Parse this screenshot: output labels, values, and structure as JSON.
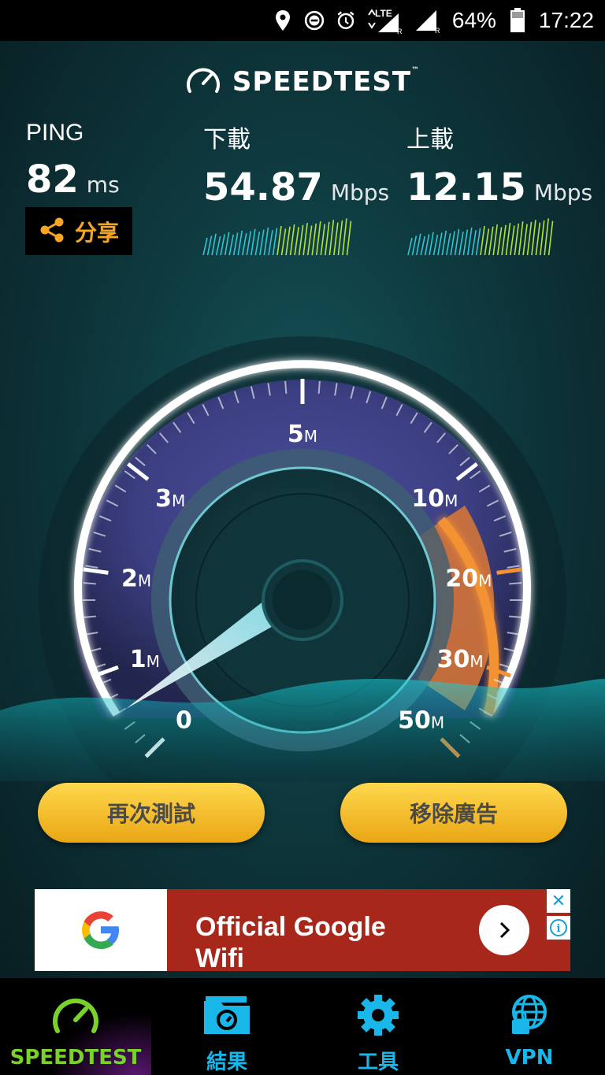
{
  "status_bar": {
    "network": "LTE",
    "battery": "64%",
    "time": "17:22",
    "icons": [
      "location-icon",
      "do-not-disturb-icon",
      "alarm-icon",
      "lte-signal-icon",
      "signal-icon",
      "battery-icon"
    ]
  },
  "header": {
    "logo_text": "SPEEDTEST",
    "trademark": "™"
  },
  "metrics": {
    "ping": {
      "label": "PING",
      "value": "82",
      "unit": "ms"
    },
    "download": {
      "label": "下載",
      "value": "54.87",
      "unit": "Mbps"
    },
    "upload": {
      "label": "上載",
      "value": "12.15",
      "unit": "Mbps"
    }
  },
  "share": {
    "label": "分享"
  },
  "gauge": {
    "ticks": [
      {
        "num": "0",
        "unit": ""
      },
      {
        "num": "1",
        "unit": "M"
      },
      {
        "num": "2",
        "unit": "M"
      },
      {
        "num": "3",
        "unit": "M"
      },
      {
        "num": "5",
        "unit": "M"
      },
      {
        "num": "10",
        "unit": "M"
      },
      {
        "num": "20",
        "unit": "M"
      },
      {
        "num": "30",
        "unit": "M"
      },
      {
        "num": "50",
        "unit": "M"
      }
    ]
  },
  "actions": {
    "retest_label": "再次測試",
    "remove_ads_label": "移除廣告"
  },
  "ad": {
    "text": "Official Google Wifi",
    "close": "✕",
    "info": "i"
  },
  "nav": {
    "items": [
      {
        "label": "SPEEDTEST",
        "active": true
      },
      {
        "label": "結果"
      },
      {
        "label": "工具"
      },
      {
        "label": "VPN"
      }
    ]
  },
  "colors": {
    "accent_green": "#7bd12c",
    "accent_blue": "#19b6ea",
    "gauge_orange": "#f29233",
    "button_gold": "#f0b423",
    "ad_red": "#a7271b"
  }
}
